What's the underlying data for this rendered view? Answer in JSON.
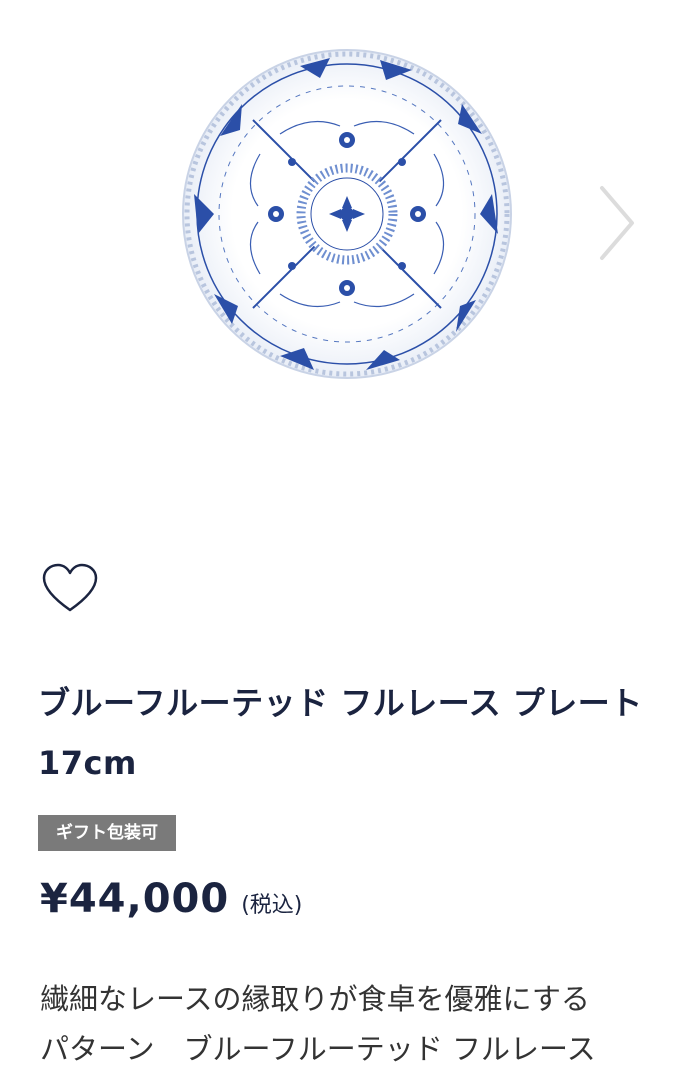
{
  "gallery": {
    "image": "blue-fluted-full-lace-plate",
    "next_icon": "chevron-right-icon"
  },
  "favorite": {
    "icon": "heart-outline-icon"
  },
  "product": {
    "title": "ブルーフルーテッド フルレース プレート 17cm",
    "badge": "ギフト包装可",
    "price": "¥44,000",
    "tax_note": "(税込)",
    "description": "繊細なレースの縁取りが食卓を優雅にする\nパターン　ブルーフルーテッド フルレース"
  },
  "colors": {
    "text_primary": "#1b2440",
    "badge_bg": "#7a7a7a",
    "plate_blue": "#2b4fa8"
  }
}
